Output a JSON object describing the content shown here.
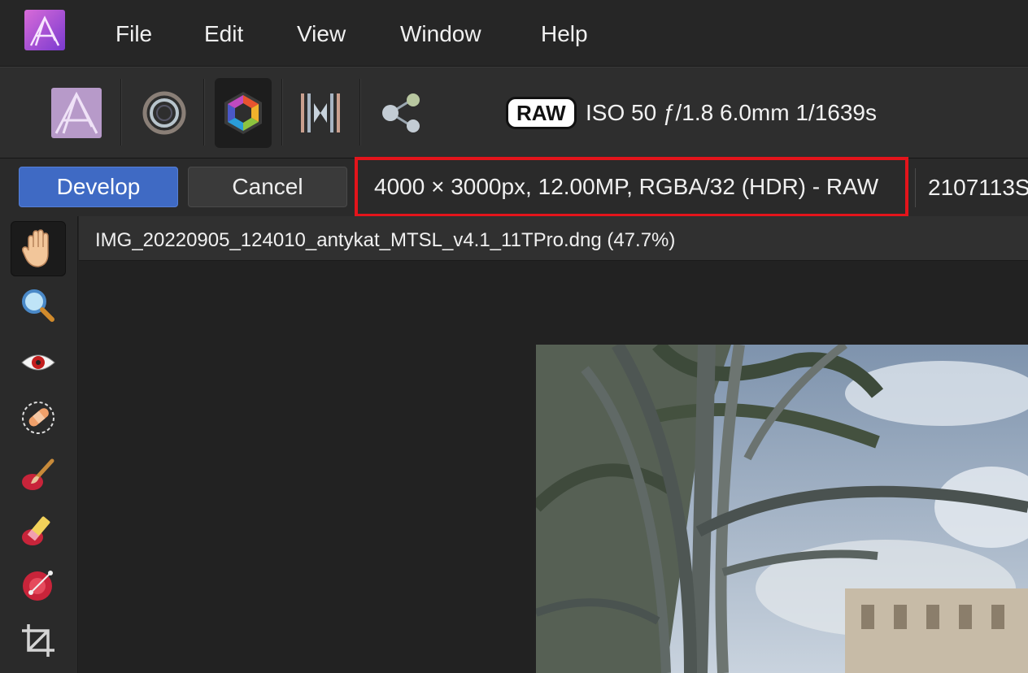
{
  "menu": {
    "items": [
      {
        "label": "File"
      },
      {
        "label": "Edit"
      },
      {
        "label": "View"
      },
      {
        "label": "Window"
      },
      {
        "label": "Help"
      }
    ]
  },
  "toolbar": {
    "personas": [
      "photo-persona-icon",
      "liquify-persona-icon",
      "develop-persona-icon",
      "tone-mapping-persona-icon",
      "export-persona-icon"
    ],
    "active_persona": "develop-persona-icon",
    "raw_badge": "RAW",
    "exif": "ISO 50 ƒ/1.8 6.0mm 1/1639s"
  },
  "context": {
    "develop_label": "Develop",
    "cancel_label": "Cancel",
    "image_info": "4000 × 3000px, 12.00MP, RGBA/32 (HDR) - RAW",
    "extra_info": "2107113S"
  },
  "tools": [
    "view-tool-hand-icon",
    "zoom-tool-icon",
    "red-eye-tool-icon",
    "blemish-removal-tool-icon",
    "overlay-paint-tool-icon",
    "overlay-erase-tool-icon",
    "overlay-gradient-tool-icon",
    "crop-tool-icon"
  ],
  "document": {
    "title": "IMG_20220905_124010_antykat_MTSL_v4.1_11TPro.dng (47.7%)"
  },
  "colors": {
    "accent": "#3f6ac4",
    "highlight_box": "#e3141b",
    "background": "#232323"
  }
}
